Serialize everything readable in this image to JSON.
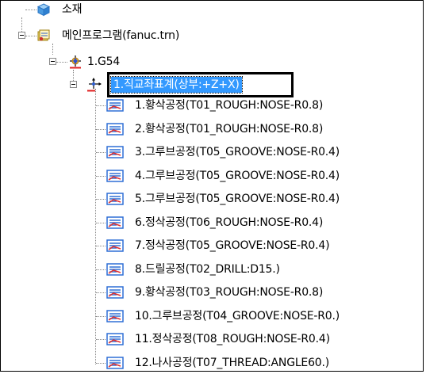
{
  "tree": {
    "root": {
      "label": "소재",
      "icon": "cube-icon"
    },
    "program": {
      "label": "메인프로그램(fanuc.trn)",
      "icon": "program-icon"
    },
    "workcoord": {
      "label": "1.G54",
      "icon": "work-coordinate-icon"
    },
    "coordsys": {
      "label": "1.직교좌표계(상부:+Z+X)",
      "icon": "axis-icon",
      "selected": true
    },
    "operations": [
      {
        "label": "1.황삭공정(T01_ROUGH:NOSE-R0.8)",
        "icon": "toolpath-icon"
      },
      {
        "label": "2.황삭공정(T01_ROUGH:NOSE-R0.8)",
        "icon": "toolpath-icon"
      },
      {
        "label": "3.그루브공정(T05_GROOVE:NOSE-R0.4)",
        "icon": "toolpath-icon"
      },
      {
        "label": "4.그루브공정(T05_GROOVE:NOSE-R0.4)",
        "icon": "toolpath-icon"
      },
      {
        "label": "5.그루브공정(T05_GROOVE:NOSE-R0.4)",
        "icon": "toolpath-icon"
      },
      {
        "label": "6.정삭공정(T06_ROUGH:NOSE-R0.4)",
        "icon": "toolpath-icon"
      },
      {
        "label": "7.정삭공정(T05_GROOVE:NOSE-R0.4)",
        "icon": "toolpath-icon"
      },
      {
        "label": "8.드릴공정(T02_DRILL:D15.)",
        "icon": "toolpath-icon"
      },
      {
        "label": "9.황삭공정(T03_ROUGH:NOSE-R0.8)",
        "icon": "toolpath-icon"
      },
      {
        "label": "10.그루브공정(T04_GROOVE:NOSE-R0.)",
        "icon": "toolpath-icon"
      },
      {
        "label": "11.정삭공정(T08_ROUGH:NOSE-R0.4)",
        "icon": "toolpath-icon"
      },
      {
        "label": "12.나사공정(T07_THREAD:ANGLE60.)",
        "icon": "toolpath-icon"
      }
    ]
  },
  "colors": {
    "selection": "#3399ff",
    "tree_line": "#8a8a8a",
    "toolpath_blue": "#2f6fd6",
    "toolpath_red": "#e03030"
  }
}
